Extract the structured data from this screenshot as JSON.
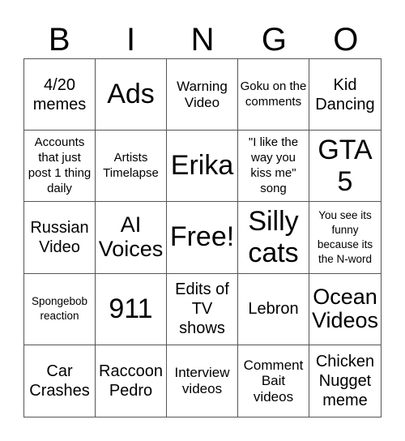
{
  "header": {
    "letters": [
      "B",
      "I",
      "N",
      "G",
      "O"
    ]
  },
  "cells": [
    {
      "text": "4/20 memes"
    },
    {
      "text": "Ads"
    },
    {
      "text": "Warning Video"
    },
    {
      "text": "Goku on the comments"
    },
    {
      "text": "Kid Dancing"
    },
    {
      "text": "Accounts that just post 1 thing daily"
    },
    {
      "text": "Artists Timelapse"
    },
    {
      "text": "Erika"
    },
    {
      "text": "\"I like the way you kiss me\" song"
    },
    {
      "text": "GTA 5"
    },
    {
      "text": "Russian Video"
    },
    {
      "text": "AI Voices"
    },
    {
      "text": "Free!"
    },
    {
      "text": "Silly cats"
    },
    {
      "text": "You see its funny because its the N-word"
    },
    {
      "text": "Spongebob reaction"
    },
    {
      "text": "911"
    },
    {
      "text": "Edits of TV shows"
    },
    {
      "text": "Lebron"
    },
    {
      "text": "Ocean Videos"
    },
    {
      "text": "Car Crashes"
    },
    {
      "text": "Raccoon Pedro"
    },
    {
      "text": "Interview videos"
    },
    {
      "text": "Comment Bait videos"
    },
    {
      "text": "Chicken Nugget meme"
    }
  ]
}
